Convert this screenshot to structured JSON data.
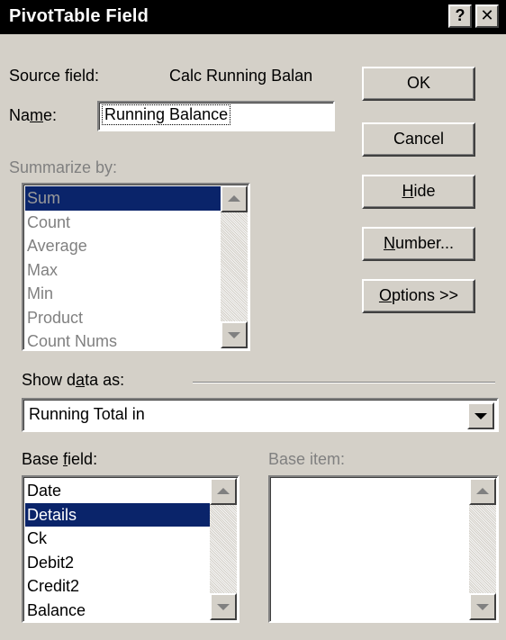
{
  "window": {
    "title": "PivotTable Field",
    "help_label": "?",
    "close_label": "✕"
  },
  "source": {
    "label": "Source field:",
    "value": "Calc Running Balan"
  },
  "name": {
    "label_pre": "Na",
    "label_key": "m",
    "label_post": "e:",
    "value": "Running Balance"
  },
  "buttons": {
    "ok": "OK",
    "cancel": "Cancel",
    "hide_key": "H",
    "hide_rest": "ide",
    "number_key": "N",
    "number_rest": "umber...",
    "options_key": "O",
    "options_rest": "ptions >>"
  },
  "summarize": {
    "label": "Summarize by:",
    "items": [
      "Sum",
      "Count",
      "Average",
      "Max",
      "Min",
      "Product",
      "Count Nums"
    ],
    "selected": "Sum"
  },
  "show_data": {
    "label_pre": "Show d",
    "label_key": "a",
    "label_post": "ta as:",
    "value": "Running Total in"
  },
  "base_field": {
    "label_pre": "Base ",
    "label_key": "f",
    "label_post": "ield:",
    "items": [
      "Date",
      "Details",
      "Ck",
      "Debit2",
      "Credit2",
      "Balance"
    ],
    "selected": "Details"
  },
  "base_item": {
    "label": "Base item:",
    "items": []
  },
  "icons": {
    "scroll_up": "up-arrow-icon",
    "scroll_down": "down-arrow-icon",
    "dropdown": "down-arrow-icon"
  },
  "colors": {
    "face": "#d4d0c8",
    "selection": "#0a246a",
    "titlebar": "#000000",
    "disabled_text": "#808080"
  }
}
